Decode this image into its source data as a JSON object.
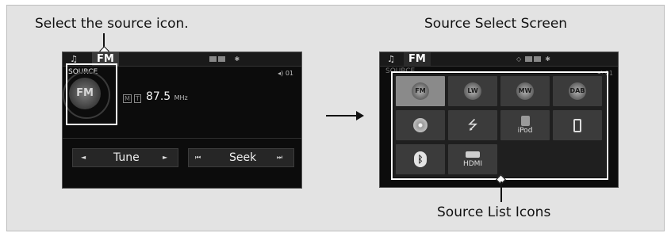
{
  "captions": {
    "left": "Select the source icon.",
    "right": "Source Select Screen",
    "bottom": "Source List Icons"
  },
  "left_screen": {
    "tab": "FM",
    "source_label": "SOURCE",
    "source_icon": "FM",
    "rds_badges": [
      "M",
      "T"
    ],
    "frequency": "87.5",
    "frequency_unit": "MHz",
    "preset": "01",
    "buttons": {
      "tune": "Tune",
      "seek": "Seek",
      "tune_left": "◄",
      "tune_right": "►",
      "seek_left": "⏮",
      "seek_right": "⏭"
    }
  },
  "right_screen": {
    "tab": "FM",
    "source_label": "SOURCE",
    "preset": "01",
    "sources": [
      {
        "label": "FM",
        "icon": "fm-dish-icon"
      },
      {
        "label": "LW",
        "icon": "lw-dish-icon"
      },
      {
        "label": "MW",
        "icon": "mw-dish-icon"
      },
      {
        "label": "DAB",
        "icon": "dab-dish-icon"
      },
      {
        "label": "",
        "icon": "disc-icon"
      },
      {
        "label": "",
        "icon": "usb-icon"
      },
      {
        "label": "iPod",
        "icon": "ipod-icon"
      },
      {
        "label": "",
        "icon": "phone-icon"
      },
      {
        "label": "",
        "icon": "bluetooth-icon"
      },
      {
        "label": "HDMI",
        "icon": "hdmi-icon"
      }
    ]
  },
  "arrow": "→",
  "colors": {
    "panel_background": "#e3e3e3",
    "screen_background": "#0c0c0c",
    "highlight": "#ffffff",
    "active_cell": "#8a8a8a"
  }
}
